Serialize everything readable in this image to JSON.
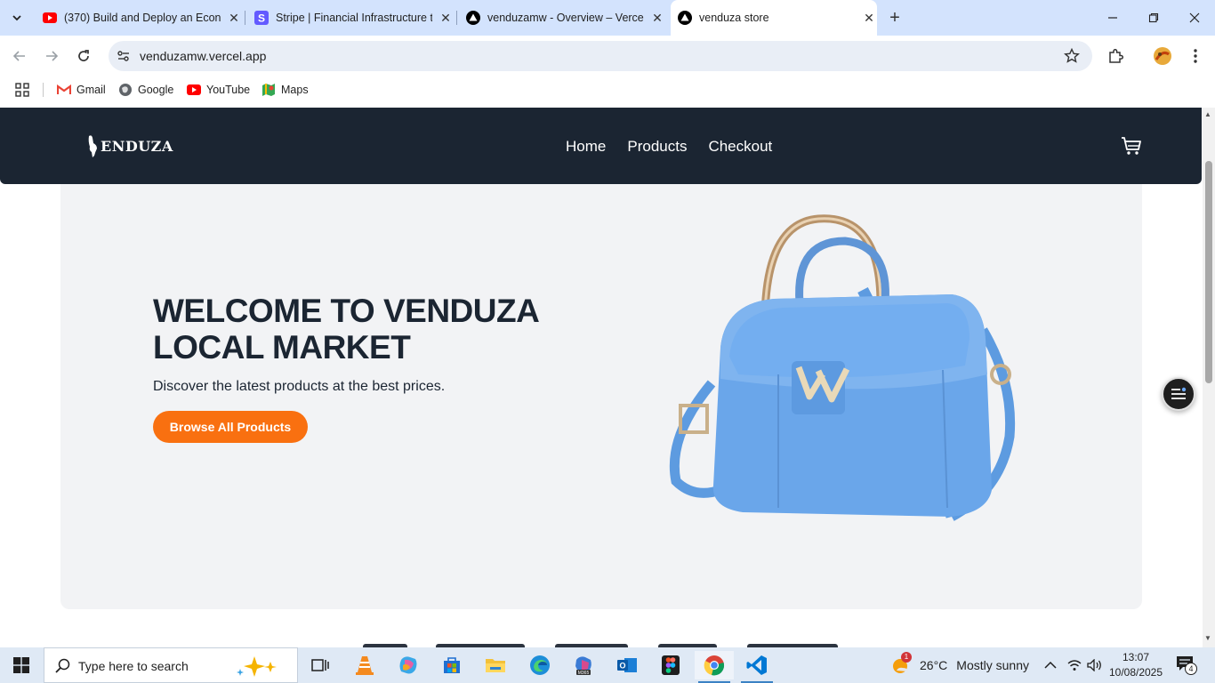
{
  "browser": {
    "tabs": [
      {
        "title": "(370) Build and Deploy an Econ",
        "favicon": "youtube-icon",
        "active": false
      },
      {
        "title": "Stripe | Financial Infrastructure t",
        "favicon": "stripe-icon",
        "active": false
      },
      {
        "title": "venduzamw - Overview – Vercel",
        "favicon": "vercel-icon",
        "active": false
      },
      {
        "title": "venduza store",
        "favicon": "vercel-icon",
        "active": true
      }
    ],
    "url": "venduzamw.vercel.app",
    "bookmarks": [
      {
        "label": "Gmail",
        "icon": "gmail-icon"
      },
      {
        "label": "Google",
        "icon": "google-icon"
      },
      {
        "label": "YouTube",
        "icon": "youtube-icon"
      },
      {
        "label": "Maps",
        "icon": "maps-icon"
      }
    ]
  },
  "site": {
    "logo_text": "ENDUZA",
    "nav": [
      "Home",
      "Products",
      "Checkout"
    ],
    "hero": {
      "title": "WELCOME TO VENDUZA LOCAL MARKET",
      "subtitle": "Discover the latest products at the best prices.",
      "cta": "Browse All Products",
      "image_alt": "blue handbag"
    },
    "colors": {
      "nav_bg": "#1b2532",
      "accent": "#f97010",
      "hero_bg": "#f2f3f5"
    }
  },
  "taskbar": {
    "search_placeholder": "Type here to search",
    "weather_temp": "26°C",
    "weather_text": "Mostly sunny",
    "weather_badge": "1",
    "time": "13:07",
    "date": "10/08/2025",
    "notification_count": "4"
  }
}
